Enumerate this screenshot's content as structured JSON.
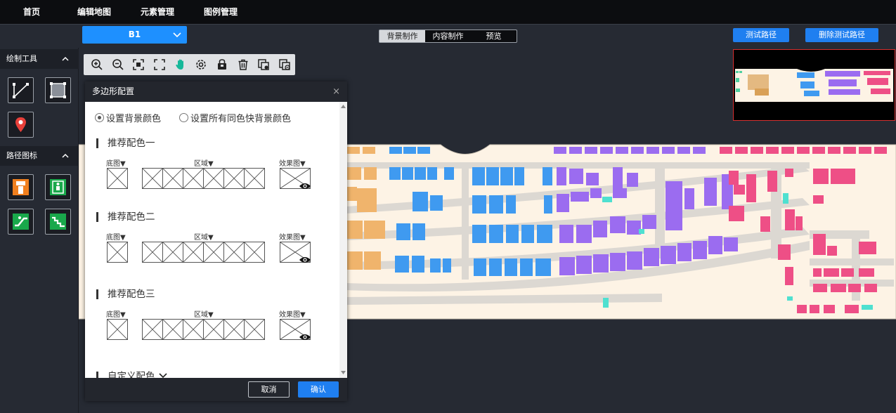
{
  "nav": {
    "items": [
      "首页",
      "编辑地图",
      "元素管理",
      "图例管理"
    ]
  },
  "floor": {
    "selected": "B1"
  },
  "mode_tabs": [
    "背景制作",
    "内容制作",
    "预览"
  ],
  "buttons": {
    "test_path": "测试路径",
    "delete_test_path": "删除测试路径"
  },
  "sidebar": {
    "draw_tools_title": "绘制工具",
    "path_icons_title": "路径图标",
    "draw_tools": [
      "line-tool-icon",
      "polygon-tool-icon",
      "location-pin-icon"
    ],
    "path_icons": [
      "elevator-icon",
      "lift-icon",
      "escalator-icon",
      "stairs-icon"
    ]
  },
  "map_toolbar": [
    "zoom-in-icon",
    "zoom-out-icon",
    "fit-view-icon",
    "fullscreen-icon",
    "pan-hand-icon",
    "settings-icon",
    "lock-icon",
    "delete-icon",
    "copy-icon",
    "paste-icon"
  ],
  "dialog": {
    "title": "多边形配置",
    "close": "×",
    "radio_bg": "设置背景颜色",
    "radio_same": "设置所有同色快背景颜色",
    "col_base": "底图▼",
    "col_area": "区域▼",
    "col_effect": "效果图▼",
    "schemes": [
      "推荐配色一",
      "推荐配色二",
      "推荐配色三"
    ],
    "custom": "自定义配色",
    "cancel": "取消",
    "ok": "确认"
  },
  "colors": {
    "accent": "#1f7ff0",
    "map_bg": "#fdf3e5",
    "road": "#dcd8d2",
    "blue_zone": "#3f9af0",
    "purple_zone": "#9b6cf0",
    "pink_zone": "#ee4f86",
    "orange_zone": "#f0b46c",
    "cyan_zone": "#4fe0d0"
  }
}
